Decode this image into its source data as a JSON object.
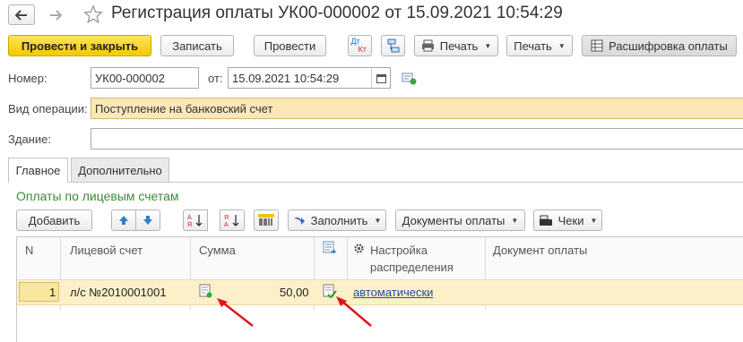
{
  "window": {
    "title": "Регистрация оплаты УК00-000002 от 15.09.2021 10:54:29"
  },
  "toolbar": {
    "post_close_label": "Провести и закрыть",
    "save_label": "Записать",
    "post_label": "Провести",
    "print_icon_label": "Печать",
    "print_label": "Печать",
    "breakdown_label": "Расшифровка оплаты",
    "dt_kt_top": "Дт",
    "dt_kt_bottom": "Кт"
  },
  "form": {
    "number_label": "Номер:",
    "number_value": "УК00-000002",
    "date_label": "от:",
    "date_value": "15.09.2021 10:54:29",
    "operation_label": "Вид операции:",
    "operation_value": "Поступление на банковский счет",
    "building_label": "Здание:",
    "building_value": ""
  },
  "tabs": [
    {
      "label": "Главное"
    },
    {
      "label": "Дополнительно"
    }
  ],
  "section": {
    "title": "Оплаты по лицевым счетам"
  },
  "table_toolbar": {
    "add_label": "Добавить",
    "fill_label": "Заполнить",
    "payment_docs_label": "Документы оплаты",
    "receipts_label": "Чеки"
  },
  "table": {
    "columns": [
      "N",
      "Лицевой счет",
      "Сумма",
      "",
      "Настройка распределения",
      "Документ оплаты"
    ],
    "column_settings_line1": "Настройка",
    "column_settings_line2": "распределения",
    "rows": [
      {
        "n": "1",
        "account": "л/с №2010001001",
        "amount": "50,00",
        "distribution": "автоматически",
        "document": ""
      }
    ]
  },
  "colors": {
    "accent_yellow": "#f5c800",
    "section_green": "#3a8a3a",
    "selected_row": "#fbf0c8",
    "operation_field_bg": "#fbe8b9",
    "link_blue": "#1f4fa8",
    "arrow_red": "#e0141e"
  }
}
